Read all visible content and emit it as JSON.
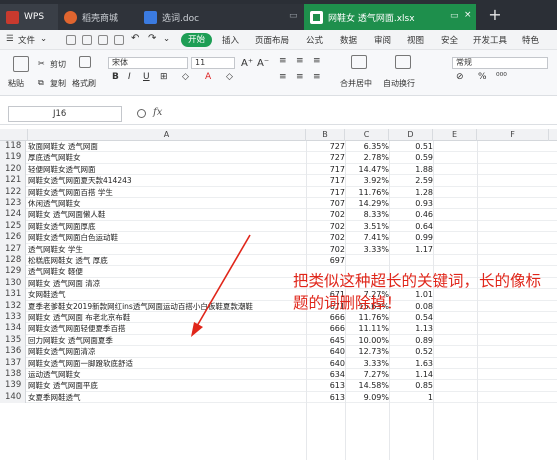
{
  "tabs": [
    {
      "label": "WPS"
    },
    {
      "label": "稻壳商城"
    },
    {
      "label": "选词.doc"
    },
    {
      "label": "网鞋女 透气网面.xlsx"
    }
  ],
  "menu": {
    "file": "文件",
    "start": "开始",
    "items": [
      "插入",
      "页面布局",
      "公式",
      "数据",
      "审阅",
      "视图",
      "安全",
      "开发工具",
      "特色"
    ]
  },
  "ribbon": {
    "paste": "粘贴",
    "cut": "剪切",
    "copy": "复制",
    "format_painter": "格式刷",
    "font_name": "宋体",
    "font_size": "11",
    "merge": "合并居中",
    "wrap": "自动换行",
    "number_format": "常规",
    "increase_font": "A⁺",
    "decrease_font": "A⁻"
  },
  "formula_bar": {
    "cell_ref": "J16",
    "fx": "fx",
    "value": ""
  },
  "columns": [
    "A",
    "B",
    "C",
    "D",
    "E",
    "F"
  ],
  "rows": [
    {
      "n": "118",
      "a": "软面网鞋女 透气网面",
      "b": "727",
      "c": "6.35%",
      "d": "0.51"
    },
    {
      "n": "119",
      "a": "厚底透气网鞋女",
      "b": "727",
      "c": "2.78%",
      "d": "0.59"
    },
    {
      "n": "120",
      "a": "轻便网鞋女透气网面",
      "b": "717",
      "c": "14.47%",
      "d": "1.88"
    },
    {
      "n": "121",
      "a": "网鞋女透气网面夏天款414243",
      "b": "717",
      "c": "3.92%",
      "d": "2.59"
    },
    {
      "n": "122",
      "a": "网鞋女透气网面百搭 学生",
      "b": "717",
      "c": "11.76%",
      "d": "1.28"
    },
    {
      "n": "123",
      "a": "休闲透气网鞋女",
      "b": "707",
      "c": "14.29%",
      "d": "0.93"
    },
    {
      "n": "124",
      "a": "网鞋女 透气网面懒人鞋",
      "b": "702",
      "c": "8.33%",
      "d": "0.46"
    },
    {
      "n": "125",
      "a": "网鞋女透气网面厚底",
      "b": "702",
      "c": "3.51%",
      "d": "0.64"
    },
    {
      "n": "126",
      "a": "网鞋女透气网面白色运动鞋",
      "b": "702",
      "c": "7.41%",
      "d": "0.99"
    },
    {
      "n": "127",
      "a": "透气网鞋女 学生",
      "b": "702",
      "c": "3.33%",
      "d": "1.17"
    },
    {
      "n": "128",
      "a": "松糕底网鞋女 透气 厚底",
      "b": "697",
      "c": "",
      "d": ""
    },
    {
      "n": "129",
      "a": "透气网鞋女 軽便",
      "b": "",
      "c": "",
      "d": ""
    },
    {
      "n": "130",
      "a": "网鞋女 透气网面 清凉",
      "b": "",
      "c": "",
      "d": ""
    },
    {
      "n": "131",
      "a": "女网鞋透气",
      "b": "671",
      "c": "7.27%",
      "d": "1.01"
    },
    {
      "n": "132",
      "a": "夏季老爹鞋女2019新款网红ins透气网面运动百搭小白板鞋夏款潮鞋",
      "b": "671",
      "c": "15.63%",
      "d": "0.08"
    },
    {
      "n": "133",
      "a": "网鞋女 透气网面 布老北京布鞋",
      "b": "666",
      "c": "11.76%",
      "d": "0.54"
    },
    {
      "n": "134",
      "a": "网鞋女透气网面轻便夏季百搭",
      "b": "666",
      "c": "11.11%",
      "d": "1.13"
    },
    {
      "n": "135",
      "a": "回力网鞋女 透气网面夏季",
      "b": "645",
      "c": "10.00%",
      "d": "0.89"
    },
    {
      "n": "136",
      "a": "网鞋女透气网面清凉",
      "b": "640",
      "c": "12.73%",
      "d": "0.52"
    },
    {
      "n": "137",
      "a": "网鞋女透气网面一脚蹬软底舒适",
      "b": "640",
      "c": "3.33%",
      "d": "1.63"
    },
    {
      "n": "138",
      "a": "运动透气网鞋女",
      "b": "634",
      "c": "7.27%",
      "d": "1.14"
    },
    {
      "n": "139",
      "a": "网鞋女 透气网面平底",
      "b": "613",
      "c": "14.58%",
      "d": "0.85"
    },
    {
      "n": "140",
      "a": "女夏季网鞋透气",
      "b": "613",
      "c": "9.09%",
      "d": "1"
    }
  ],
  "annotation": "把类似这种超长的关键词，长的像标题的词删除掉！",
  "colors": {
    "tabbar": "#2b2f36",
    "active_tab": "#1e8f4c",
    "start_button": "#1e9e55",
    "annotation": "#e0261a"
  }
}
